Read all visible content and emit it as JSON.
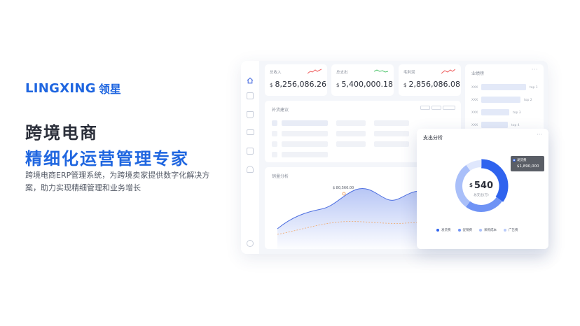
{
  "brand": {
    "en": "LINGXING",
    "cn": "领星",
    "color": "#1f66e0"
  },
  "headline": {
    "line1": "跨境电商",
    "line2": "精细化运营管理专家"
  },
  "description": "跨境电商ERP管理系统，为跨境卖家提供数字化解决方案，助力实现精细管理和业务增长",
  "dashboard": {
    "sidebar_icons": [
      "home-icon",
      "calendar-icon",
      "cart-icon",
      "truck-icon",
      "chart-icon",
      "headset-icon",
      "settings-icon"
    ],
    "kpis": [
      {
        "label": "总收入",
        "currency": "$",
        "value": "8,256,086.26",
        "trend": "up"
      },
      {
        "label": "总支出",
        "currency": "$",
        "value": "5,400,000.18",
        "trend": "flat"
      },
      {
        "label": "毛利润",
        "currency": "$",
        "value": "2,856,086.08",
        "trend": "up"
      }
    ],
    "restock": {
      "title": "补货建议",
      "pills": [
        "本周",
        "本月",
        "自定义"
      ]
    },
    "ranking": {
      "title": "业绩榜",
      "rows": [
        {
          "label": "XXX",
          "rank": "top 1",
          "level": 0.9
        },
        {
          "label": "XXX",
          "rank": "top 2",
          "level": 0.75
        },
        {
          "label": "XXX",
          "rank": "top 3",
          "level": 0.55
        },
        {
          "label": "XXX",
          "rank": "top 4",
          "level": 0.5
        }
      ]
    },
    "sales": {
      "title": "销量分析",
      "peak_label": "$ 80,566.00"
    },
    "expense": {
      "title": "支出分析",
      "center_currency": "$",
      "center_value": "540",
      "center_label": "总支出(万)",
      "tooltip_name": "发货费",
      "tooltip_value": "$1,890,000",
      "chart_data": {
        "type": "pie",
        "categories": [
          "发货费",
          "促销费",
          "采购成本",
          "广告费"
        ],
        "values": [
          35,
          25,
          30,
          10
        ],
        "colors": [
          "#2f63ee",
          "#6f93f5",
          "#a9bff9",
          "#dfe7fd"
        ]
      }
    }
  }
}
